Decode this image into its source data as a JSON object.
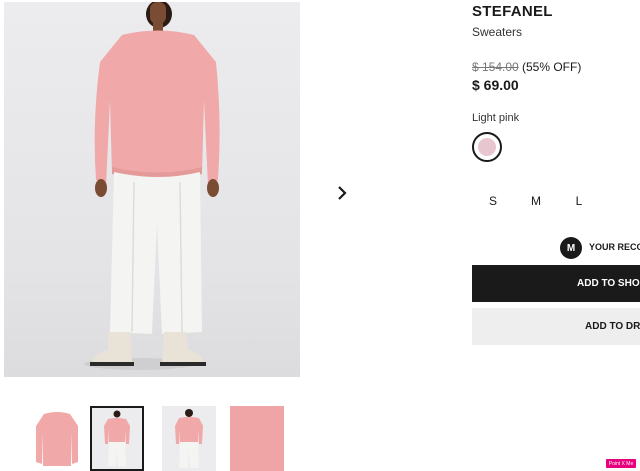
{
  "product": {
    "brand": "STEFANEL",
    "category": "Sweaters",
    "original_price": "$ 154.00",
    "discount": "(55% OFF)",
    "price": "$ 69.00",
    "color_name": "Light pink",
    "swatch_color": "#e7c6cf"
  },
  "sizes": [
    "S",
    "M",
    "L"
  ],
  "recommendation": {
    "avatar_letter": "M",
    "text": "YOUR RECO"
  },
  "actions": {
    "add_to_bag": "ADD TO SHO",
    "add_to_wishlist": "ADD TO DR"
  },
  "gallery": {
    "thumbnail_count": 4,
    "active_thumbnail": 2
  },
  "badge": "Point X Me",
  "colors": {
    "sweater": "#f0a8a8",
    "trousers": "#f4f4f2",
    "primary_button": "#1a1a1a"
  }
}
